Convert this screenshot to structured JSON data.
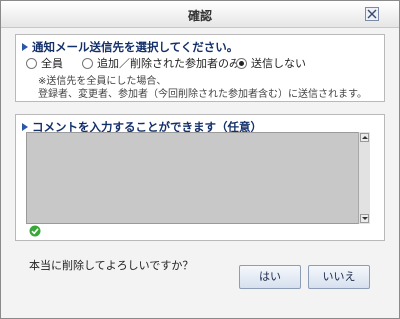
{
  "dialog": {
    "title": "確認",
    "close_icon": "close-icon"
  },
  "notify": {
    "heading": "通知メール送信先を選択してください。",
    "options": [
      {
        "label": "全員",
        "checked": false
      },
      {
        "label": "追加／削除された参加者のみ",
        "checked": false
      },
      {
        "label": "送信しない",
        "checked": true
      }
    ],
    "note_line1": "※送信先を全員にした場合、",
    "note_line2": "登録者、変更者、参加者（今回削除された参加者含む）に送信されます。"
  },
  "comment": {
    "heading": "コメントを入力することができます（任意）",
    "value": ""
  },
  "status_icon": "check-circle-icon",
  "confirm": {
    "question": "本当に削除してよろしいですか？",
    "yes_label": "はい",
    "no_label": "いいえ"
  },
  "colors": {
    "heading": "#14306a",
    "bullet": "#2a55a8",
    "comment_bg": "#c8c8c8",
    "status_green": "#3aa53a"
  }
}
